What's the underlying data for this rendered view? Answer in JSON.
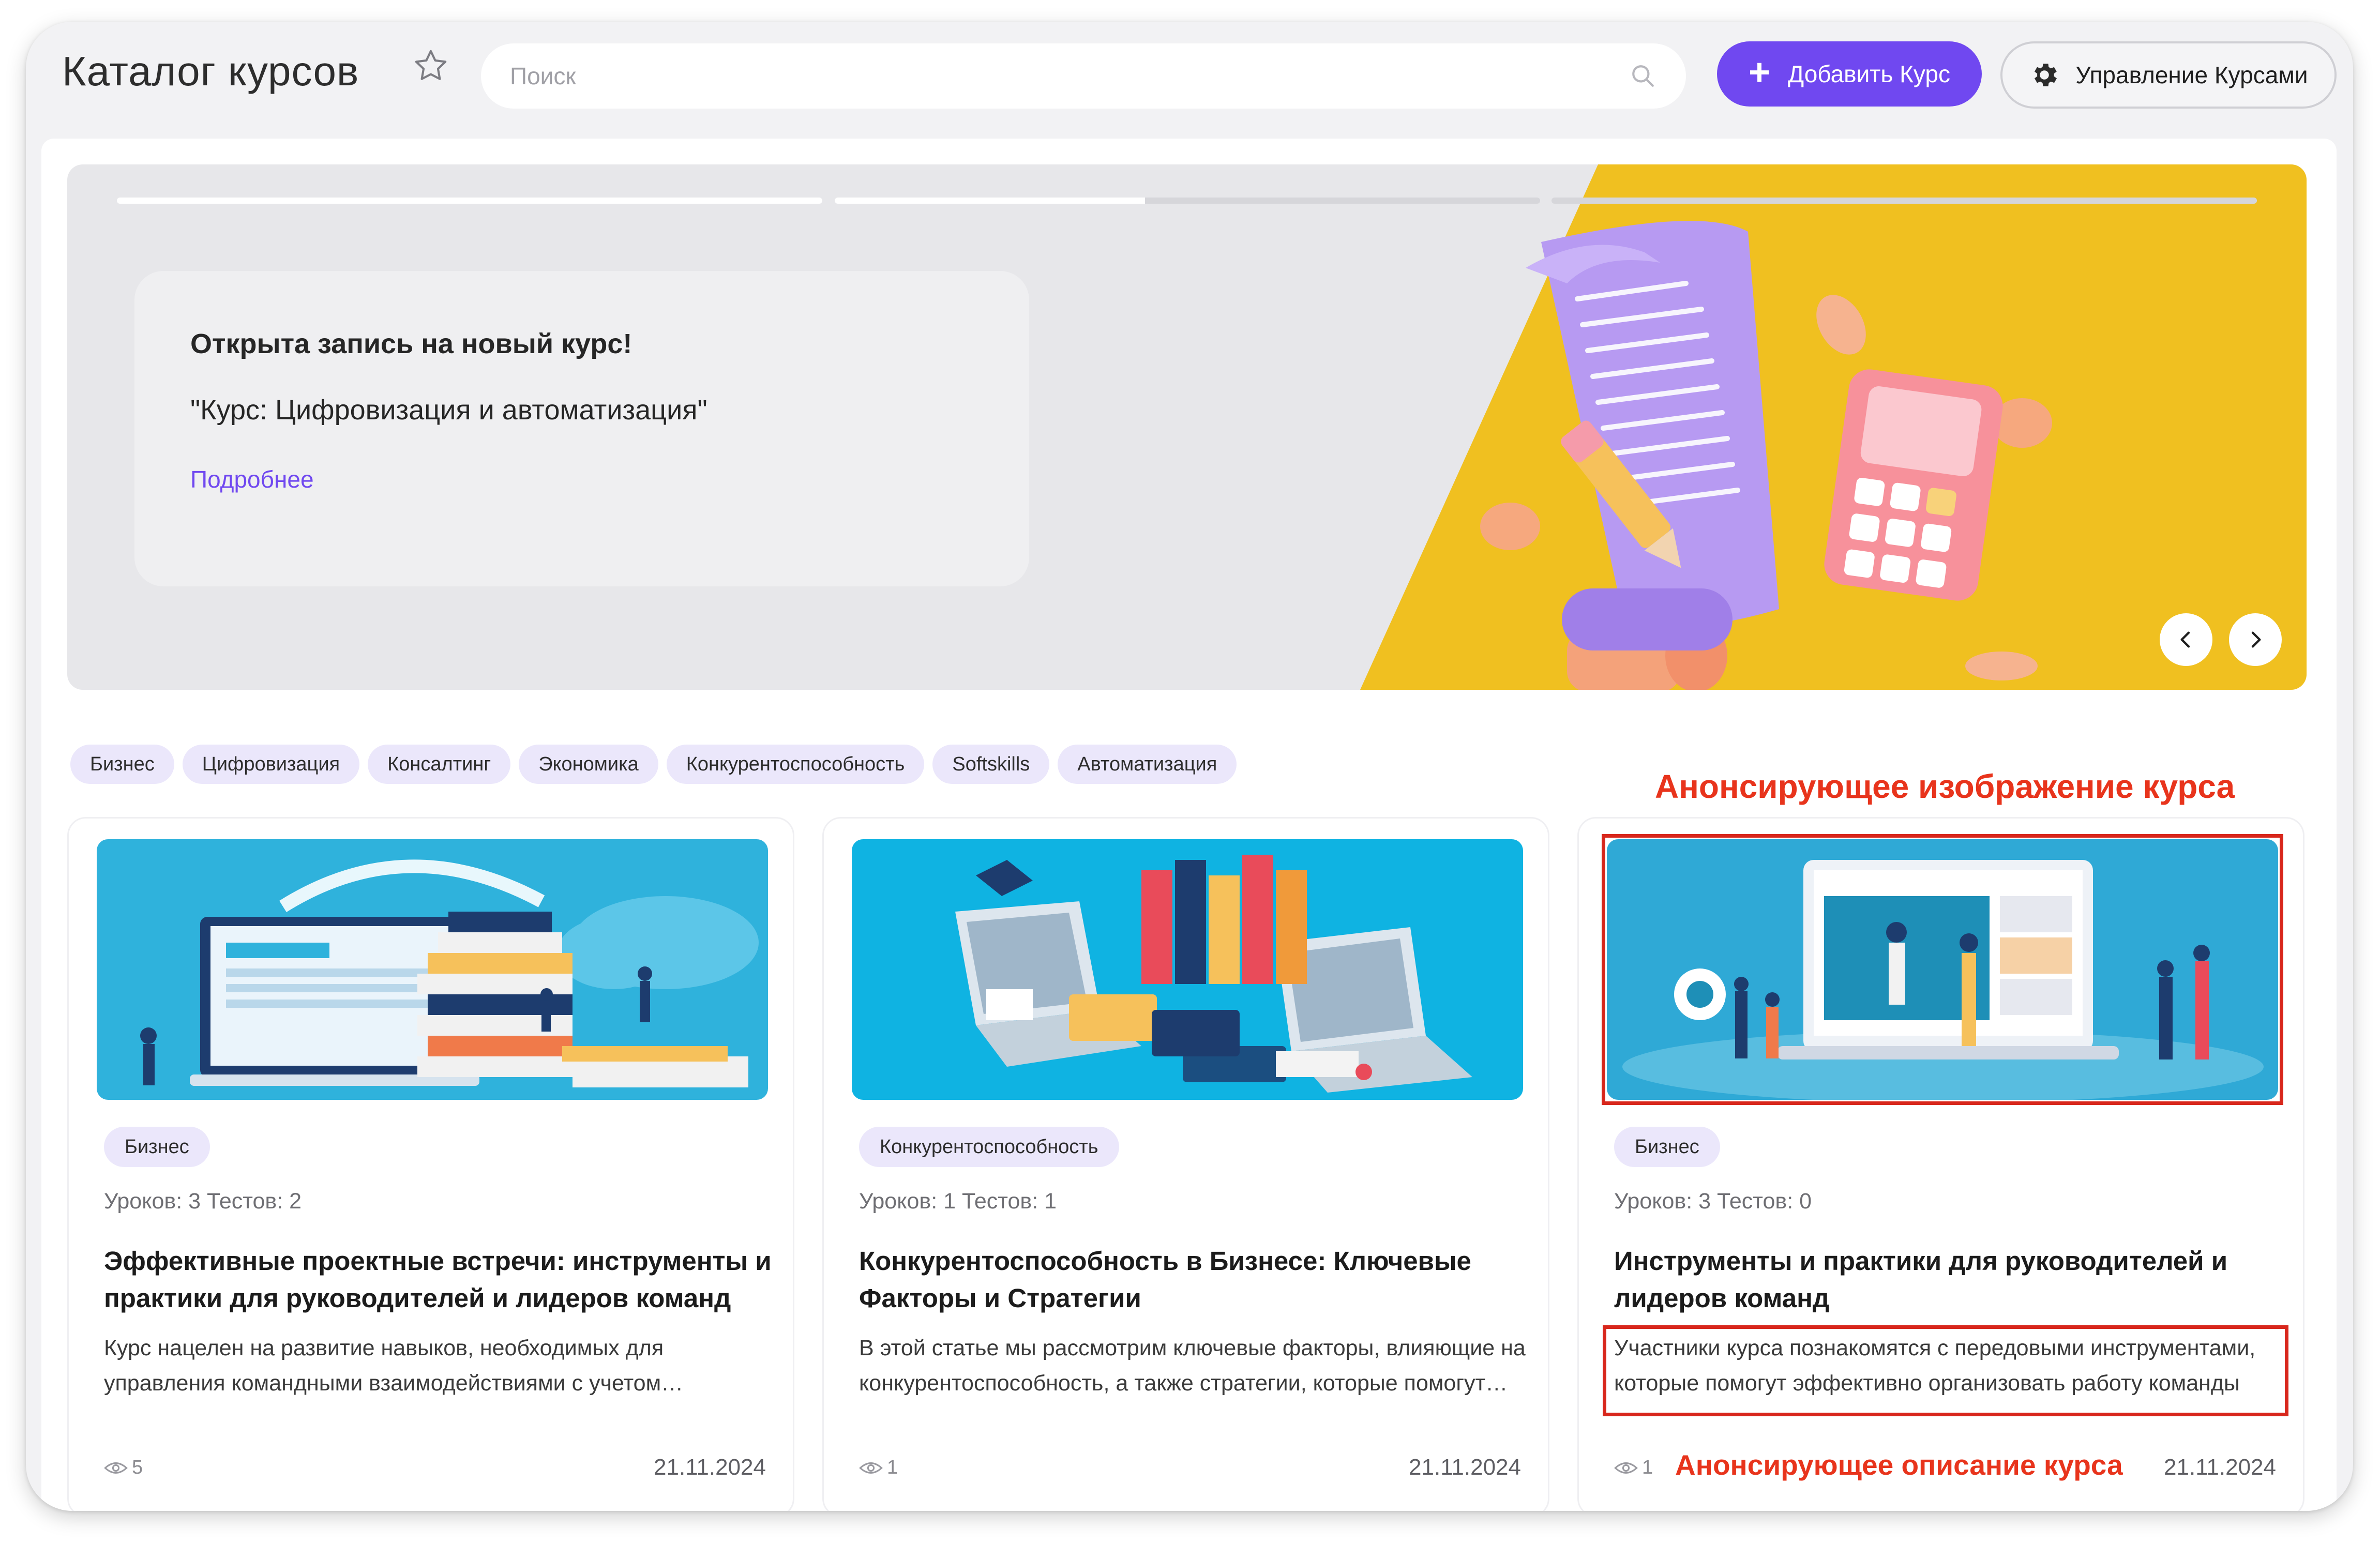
{
  "header": {
    "title": "Каталог курсов",
    "search_placeholder": "Поиск",
    "add_button_label": "Добавить Курс",
    "manage_button_label": "Управление Курсами"
  },
  "banner": {
    "heading": "Открыта запись на новый курс!",
    "subtitle": "\"Курс: Цифровизация и автоматизация\"",
    "link": "Подробнее",
    "slides_progress": [
      1.0,
      0.44,
      0.0
    ]
  },
  "tags": [
    "Бизнес",
    "Цифровизация",
    "Консалтинг",
    "Экономика",
    "Конкурентоспособность",
    "Softskills",
    "Автоматизация"
  ],
  "annotations": {
    "image_label": "Анонсирующее изображение курса",
    "description_label": "Анонсирующее описание курса"
  },
  "courses": [
    {
      "category": "Бизнес",
      "meta": "Уроков: 3 Тестов: 2",
      "title": "Эффективные проектные встречи: инструменты и практики для руководителей и лидеров команд",
      "description": "Курс нацелен на развитие навыков, необходимых для управления командными взаимодействиями с учетом современных подходов",
      "views": "5",
      "date": "21.11.2024"
    },
    {
      "category": "Конкурентоспособность",
      "meta": "Уроков: 1 Тестов: 1",
      "title": "Конкурентоспособность в Бизнесе: Ключевые Факторы и Стратегии",
      "description": "В этой статье мы рассмотрим ключевые факторы, влияющие на конкурентоспособность, а также стратегии, которые помогут бизнесу",
      "views": "1",
      "date": "21.11.2024"
    },
    {
      "category": "Бизнес",
      "meta": "Уроков: 3 Тестов: 0",
      "title": "Инструменты и практики для руководителей и лидеров команд",
      "description": "Участники курса познакомятся с передовыми инструментами, которые помогут эффективно организовать работу команды",
      "views": "1",
      "date": "21.11.2024"
    }
  ],
  "colors": {
    "accent": "#7048f0",
    "banner_yellow": "#f0c020",
    "tag_bg": "#ebe7fb",
    "annotation_red": "#e8341c",
    "thumb_blue": "#2fb2dc"
  }
}
